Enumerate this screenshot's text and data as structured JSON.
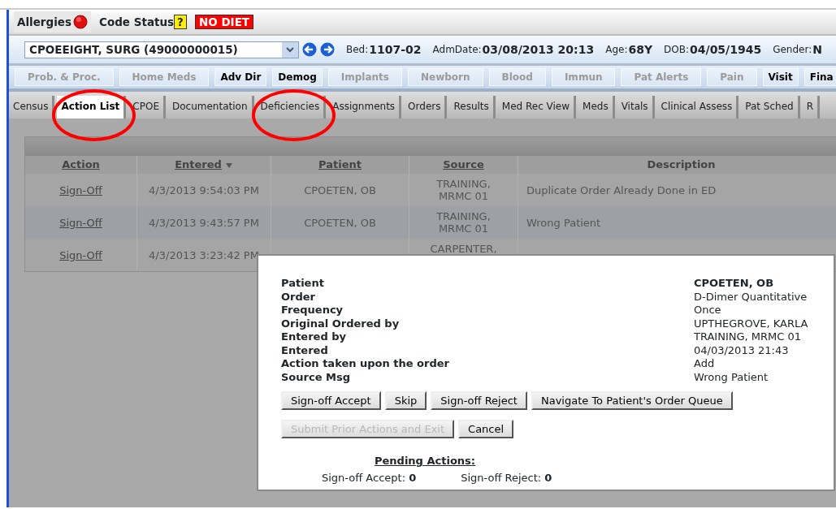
{
  "alerts": {
    "allergies": "Allergies",
    "code_status": "Code Status",
    "code_status_value": "?",
    "diet": "NO DIET"
  },
  "patient_bar": {
    "patient": "CPOEEIGHT, SURG (49000000015)",
    "fields": [
      {
        "label": "Bed:",
        "value": "1107-02"
      },
      {
        "label": "AdmDate:",
        "value": "03/08/2013 20:13"
      },
      {
        "label": "Age:",
        "value": "68Y"
      },
      {
        "label": "DOB:",
        "value": "04/05/1945"
      },
      {
        "label": "Gender:",
        "value": "N"
      }
    ]
  },
  "subtabs": [
    {
      "label": "Prob. & Proc.",
      "disabled": true
    },
    {
      "label": "Home Meds",
      "disabled": true
    },
    {
      "label": "Adv Dir",
      "disabled": false
    },
    {
      "label": "Demog",
      "disabled": false
    },
    {
      "label": "Implants",
      "disabled": true
    },
    {
      "label": "Newborn",
      "disabled": true
    },
    {
      "label": "Blood",
      "disabled": true
    },
    {
      "label": "Immun",
      "disabled": true
    },
    {
      "label": "Pat Alerts",
      "disabled": true
    },
    {
      "label": "Pain",
      "disabled": true
    },
    {
      "label": "Visit",
      "disabled": false
    },
    {
      "label": "Fina",
      "disabled": false
    }
  ],
  "tabs": [
    {
      "label": "Census",
      "selected": false,
      "circled": false
    },
    {
      "label": "Action List",
      "selected": true,
      "circled": true
    },
    {
      "label": "CPOE",
      "selected": false,
      "circled": false
    },
    {
      "label": "Documentation",
      "selected": false,
      "circled": false
    },
    {
      "label": "Deficiencies",
      "selected": false,
      "circled": true
    },
    {
      "label": "Assignments",
      "selected": false,
      "circled": false
    },
    {
      "label": "Orders",
      "selected": false,
      "circled": false
    },
    {
      "label": "Results",
      "selected": false,
      "circled": false
    },
    {
      "label": "Med Rec View",
      "selected": false,
      "circled": false
    },
    {
      "label": "Meds",
      "selected": false,
      "circled": false
    },
    {
      "label": "Vitals",
      "selected": false,
      "circled": false
    },
    {
      "label": "Clinical Assess",
      "selected": false,
      "circled": false
    },
    {
      "label": "Pat Sched",
      "selected": false,
      "circled": false
    },
    {
      "label": "R",
      "selected": false,
      "circled": false
    }
  ],
  "table": {
    "columns": [
      {
        "label": "Action",
        "sortable": true,
        "sorted": false
      },
      {
        "label": "Entered",
        "sortable": true,
        "sorted": true
      },
      {
        "label": "Patient",
        "sortable": true,
        "sorted": false
      },
      {
        "label": "Source",
        "sortable": true,
        "sorted": false
      },
      {
        "label": "Description",
        "sortable": false,
        "sorted": false
      }
    ],
    "rows": [
      {
        "action": "Sign-Off",
        "entered": "4/3/2013 9:54:03 PM",
        "patient": "CPOETEN, OB",
        "source": "TRAINING, MRMC 01",
        "description": "Duplicate Order Already Done in ED"
      },
      {
        "action": "Sign-Off",
        "entered": "4/3/2013 9:43:57 PM",
        "patient": "CPOETEN, OB",
        "source": "TRAINING, MRMC 01",
        "description": "Wrong Patient"
      },
      {
        "action": "Sign-Off",
        "entered": "4/3/2013 3:23:42 PM",
        "source": "CARPENTER,"
      }
    ]
  },
  "dialog": {
    "details": [
      {
        "label": "Patient",
        "value": "CPOETEN, OB",
        "bold": true
      },
      {
        "label": "Order",
        "value": "D-Dimer Quantitative",
        "bold": false
      },
      {
        "label": "Frequency",
        "value": "Once",
        "bold": false
      },
      {
        "label": "Original Ordered by",
        "value": "UPTHEGROVE, KARLA",
        "bold": false
      },
      {
        "label": "Entered by",
        "value": "TRAINING, MRMC 01",
        "bold": false
      },
      {
        "label": "Entered",
        "value": "04/03/2013 21:43",
        "bold": false
      },
      {
        "label": "Action taken upon the order",
        "value": "Add",
        "bold": false
      },
      {
        "label": "Source Msg",
        "value": "Wrong Patient",
        "bold": false
      }
    ],
    "button_rows": [
      [
        {
          "label": "Sign-off Accept",
          "disabled": false
        },
        {
          "label": "Skip",
          "disabled": false
        },
        {
          "label": "Sign-off Reject",
          "disabled": false
        },
        {
          "label": "Navigate To Patient's Order Queue",
          "disabled": false
        }
      ],
      [
        {
          "label": "Submit Prior Actions and Exit",
          "disabled": true
        },
        {
          "label": "Cancel",
          "disabled": false
        }
      ]
    ],
    "pending": {
      "title": "Pending Actions:",
      "counts": [
        {
          "label": "Sign-off Accept:",
          "value": "0"
        },
        {
          "label": "Sign-off Reject:",
          "value": "0"
        }
      ]
    }
  }
}
